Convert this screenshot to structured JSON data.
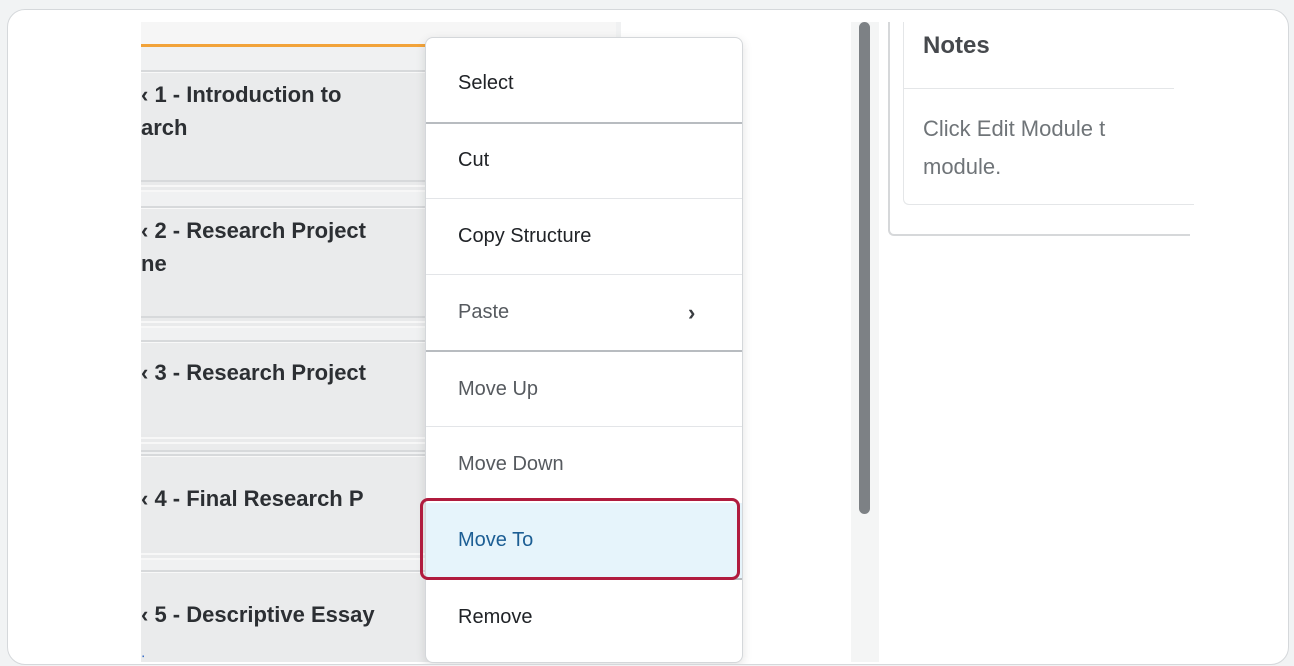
{
  "modules": [
    {
      "line1": "‹ 1 - Introduction to",
      "line2": "arch"
    },
    {
      "line1": "‹ 2 - Research Project",
      "line2": "ne"
    },
    {
      "line1": "‹ 3 - Research Project",
      "line2": ""
    },
    {
      "line1": "‹ 4 - Final Research P",
      "line2": ""
    },
    {
      "line1": "‹ 5 - Descriptive Essay",
      "line2": ""
    }
  ],
  "link_mark": ":",
  "notes": {
    "title": "Notes",
    "body_line1": "Click Edit Module t",
    "body_line2": "module."
  },
  "context_menu": {
    "items": [
      {
        "label": "Select"
      },
      {
        "label": "Cut"
      },
      {
        "label": "Copy Structure"
      },
      {
        "label": "Paste",
        "submenu_indicator": "›"
      },
      {
        "label": "Move Up"
      },
      {
        "label": "Move Down"
      },
      {
        "label": "Move To",
        "highlighted": true
      },
      {
        "label": "Remove"
      }
    ]
  },
  "colors": {
    "accent_tab": "#f2a33a",
    "highlight_bg": "#e6f4fb",
    "highlight_text": "#1c5e94",
    "focus_ring": "#b01b3e"
  }
}
